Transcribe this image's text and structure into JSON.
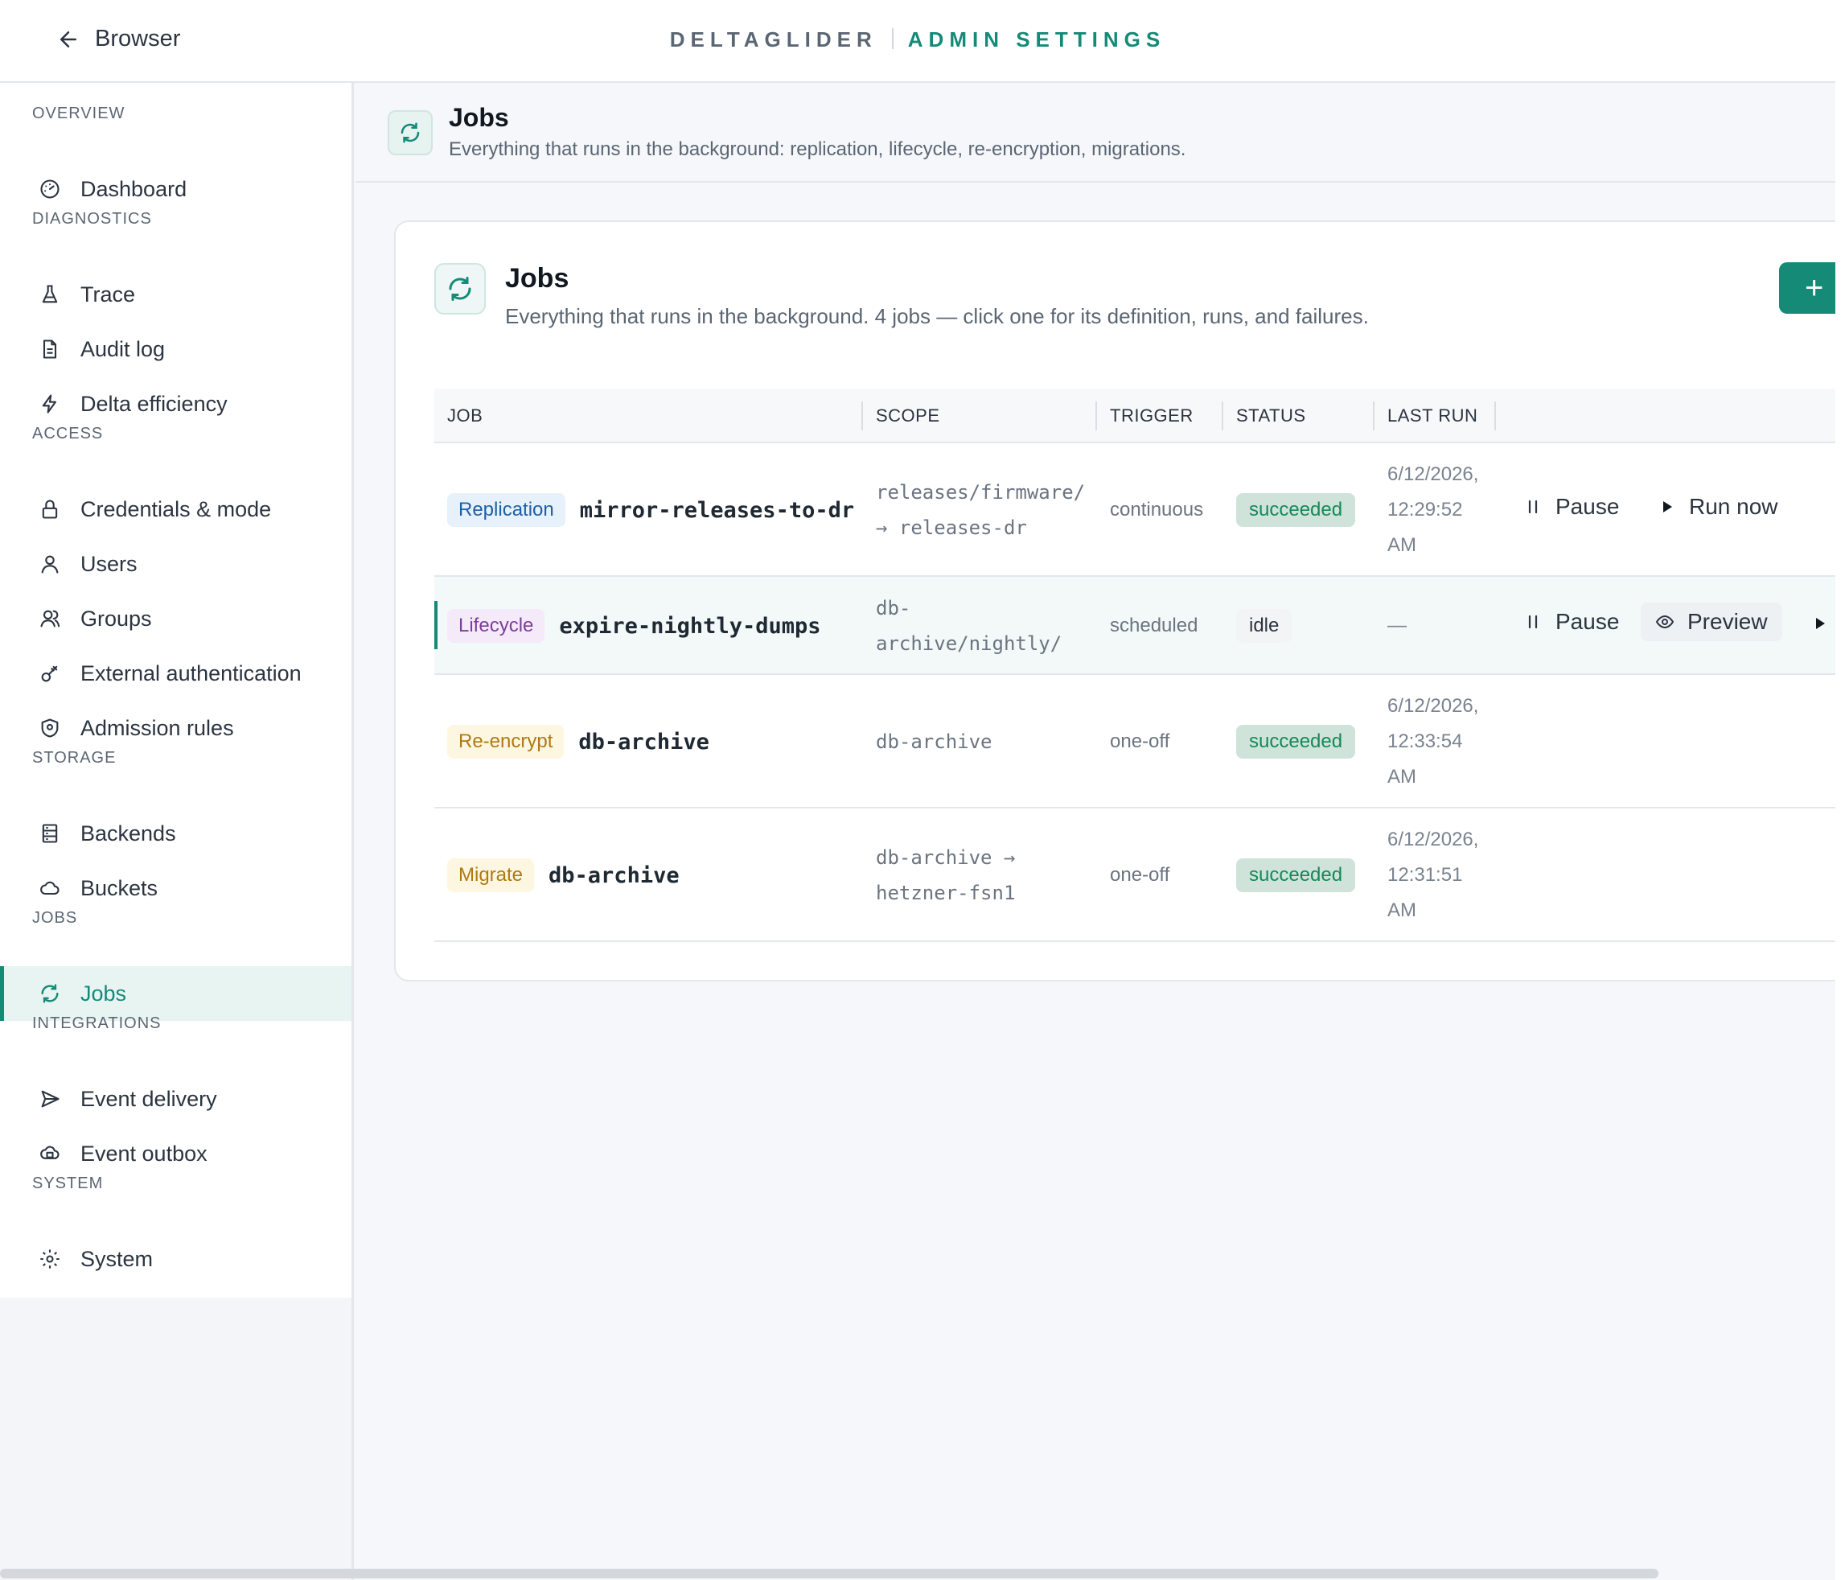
{
  "topbar": {
    "back_label": "Browser",
    "brand": "DELTAGLIDER",
    "section": "ADMIN SETTINGS"
  },
  "sidebar": {
    "sections": [
      {
        "title": "OVERVIEW",
        "items": [
          {
            "label": "Dashboard",
            "icon": "gauge-icon"
          }
        ]
      },
      {
        "title": "DIAGNOSTICS",
        "items": [
          {
            "label": "Trace",
            "icon": "flask-icon"
          },
          {
            "label": "Audit log",
            "icon": "document-icon"
          },
          {
            "label": "Delta efficiency",
            "icon": "bolt-icon"
          }
        ]
      },
      {
        "title": "ACCESS",
        "items": [
          {
            "label": "Credentials & mode",
            "icon": "lock-icon"
          },
          {
            "label": "Users",
            "icon": "user-icon"
          },
          {
            "label": "Groups",
            "icon": "users-icon"
          },
          {
            "label": "External authentication",
            "icon": "key-icon"
          },
          {
            "label": "Admission rules",
            "icon": "shield-icon"
          }
        ]
      },
      {
        "title": "STORAGE",
        "items": [
          {
            "label": "Backends",
            "icon": "server-icon"
          },
          {
            "label": "Buckets",
            "icon": "cloud-icon"
          }
        ]
      },
      {
        "title": "JOBS",
        "items": [
          {
            "label": "Jobs",
            "icon": "refresh-icon",
            "active": true
          }
        ]
      },
      {
        "title": "INTEGRATIONS",
        "items": [
          {
            "label": "Event delivery",
            "icon": "send-icon"
          },
          {
            "label": "Event outbox",
            "icon": "outbox-icon"
          }
        ]
      },
      {
        "title": "SYSTEM",
        "items": [
          {
            "label": "System",
            "icon": "gear-icon"
          }
        ]
      }
    ]
  },
  "page": {
    "title": "Jobs",
    "subtitle": "Everything that runs in the background: replication, lifecycle, re-encryption, migrations."
  },
  "card": {
    "title": "Jobs",
    "subtitle": "Everything that runs in the background. 4 jobs — click one for its definition, runs, and failures.",
    "add_label": "+"
  },
  "table": {
    "columns": [
      "JOB",
      "SCOPE",
      "TRIGGER",
      "STATUS",
      "LAST RUN"
    ],
    "rows": [
      {
        "kind": "Replication",
        "name": "mirror-releases-to-dr",
        "scope_1": "releases/firmware/",
        "scope_2": "→ releases-dr",
        "trigger": "continuous",
        "status": "succeeded",
        "last_1": "6/12/2026,",
        "last_2": "12:29:52",
        "last_3": "AM",
        "action_1": "Pause",
        "action_2": "Run now"
      },
      {
        "kind": "Lifecycle",
        "name": "expire-nightly-dumps",
        "scope_1": "db-",
        "scope_2": "archive/nightly/",
        "trigger": "scheduled",
        "status": "idle",
        "last_1": "—",
        "action_1": "Pause",
        "action_2": "Preview"
      },
      {
        "kind": "Re-encrypt",
        "name": "db-archive",
        "scope_1": "db-archive",
        "trigger": "one-off",
        "status": "succeeded",
        "last_1": "6/12/2026,",
        "last_2": "12:33:54",
        "last_3": "AM"
      },
      {
        "kind": "Migrate",
        "name": "db-archive",
        "scope_1": "db-archive →",
        "scope_2": "hetzner-fsn1",
        "trigger": "one-off",
        "status": "succeeded",
        "last_1": "6/12/2026,",
        "last_2": "12:31:51",
        "last_3": "AM"
      }
    ]
  },
  "colors": {
    "accent": "#148a77",
    "success_bg": "#cfe3da",
    "success_text": "#148a5a"
  }
}
